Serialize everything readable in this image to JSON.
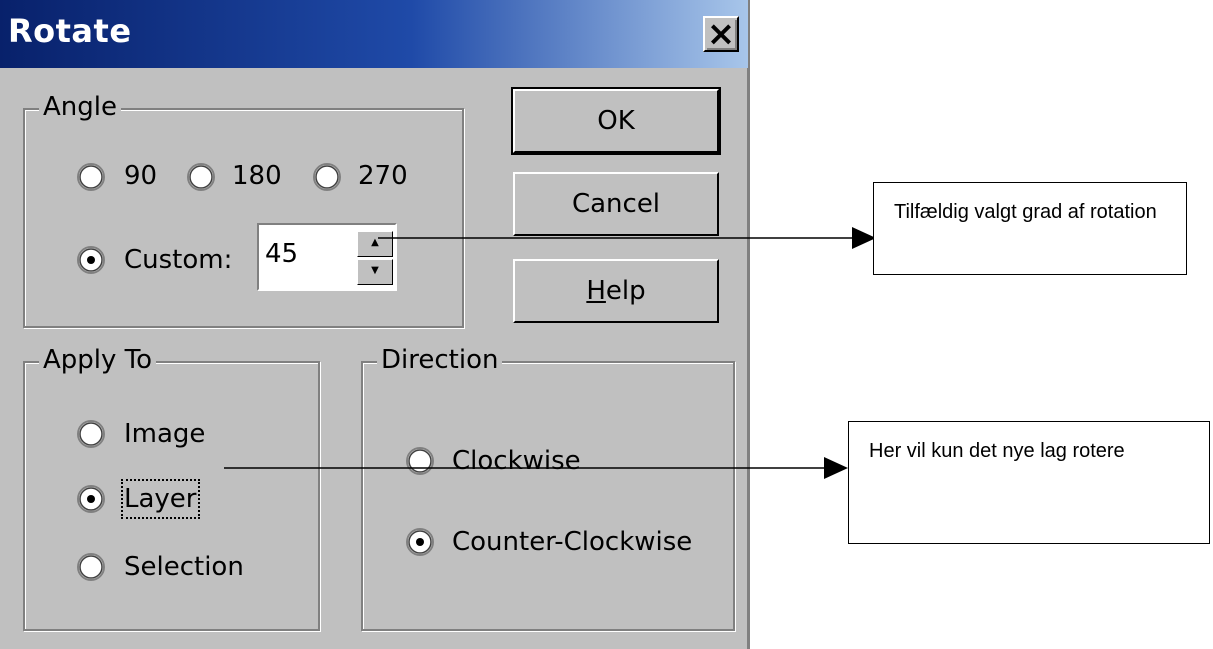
{
  "window": {
    "title": "Rotate",
    "close_glyph": "✕"
  },
  "angle": {
    "legend": "Angle",
    "options": [
      "90",
      "180",
      "270"
    ],
    "custom_label": "Custom:",
    "custom_value": "45",
    "selected": "Custom:"
  },
  "buttons": {
    "ok": "OK",
    "cancel": "Cancel",
    "help_mnemonic": "H",
    "help_rest": "elp"
  },
  "apply_to": {
    "legend": "Apply To",
    "options": [
      "Image",
      "Layer",
      "Selection"
    ],
    "selected": "Layer"
  },
  "direction": {
    "legend": "Direction",
    "options": [
      "Clockwise",
      "Counter-Clockwise"
    ],
    "selected": "Counter-Clockwise"
  },
  "annotations": {
    "angle_note": "Tilfældig valgt grad af rotation",
    "layer_note": "Her vil kun det nye lag rotere"
  },
  "colors": {
    "titlebar_start": "#08216b",
    "titlebar_end": "#a8c6ea",
    "face": "#c0c0c0"
  }
}
